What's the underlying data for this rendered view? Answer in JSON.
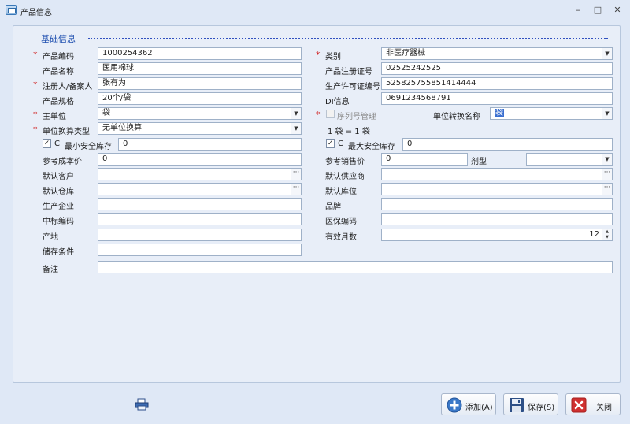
{
  "window": {
    "title": "产品信息",
    "controls": {
      "minimize": "–",
      "maximize": "□",
      "close": "✕"
    }
  },
  "section": {
    "title": "基础信息"
  },
  "left": {
    "product_code": {
      "label": "产品编码",
      "value": "1000254362"
    },
    "product_name": {
      "label": "产品名称",
      "value": "医用棉球"
    },
    "registrant": {
      "label": "注册人/备案人",
      "value": "张有为"
    },
    "spec": {
      "label": "产品规格",
      "value": "20个/袋"
    },
    "main_unit": {
      "label": "主单位",
      "value": "袋"
    },
    "unit_conv_type": {
      "label": "单位换算类型",
      "value": "无单位换算"
    },
    "min_stock": {
      "flag": "C",
      "label": "最小安全库存",
      "value": "0"
    },
    "ref_cost": {
      "label": "参考成本价",
      "value": "0"
    },
    "default_customer": {
      "label": "默认客户",
      "value": ""
    },
    "default_warehouse": {
      "label": "默认仓库",
      "value": ""
    },
    "manufacturer": {
      "label": "生产企业",
      "value": ""
    },
    "bid_code": {
      "label": "中标编码",
      "value": ""
    },
    "origin": {
      "label": "产地",
      "value": ""
    },
    "storage": {
      "label": "储存条件",
      "value": ""
    },
    "remark": {
      "label": "备注",
      "value": ""
    }
  },
  "right": {
    "category": {
      "label": "类别",
      "value": "非医疗器械"
    },
    "reg_cert": {
      "label": "产品注册证号",
      "value": "02525242525"
    },
    "license": {
      "label": "生产许可证编号",
      "value": "525825755851414444"
    },
    "di": {
      "label": "DI信息",
      "value": "0691234568791"
    },
    "serial_mgmt": {
      "label": "序列号管理"
    },
    "unit_conv_name": {
      "label": "单位转换名称",
      "value": "袋"
    },
    "conversion": "1 袋 = 1 袋",
    "max_stock": {
      "flag": "C",
      "label": "最大安全库存",
      "value": "0"
    },
    "ref_price": {
      "label": "参考销售价",
      "value": "0"
    },
    "dosage_form": {
      "label": "剂型",
      "value": ""
    },
    "default_supplier": {
      "label": "默认供应商",
      "value": ""
    },
    "default_location": {
      "label": "默认库位",
      "value": ""
    },
    "brand": {
      "label": "品牌",
      "value": ""
    },
    "med_code": {
      "label": "医保编码",
      "value": ""
    },
    "valid_months": {
      "label": "有效月数",
      "value": "12"
    }
  },
  "markers": {
    "required": "*",
    "dropdown": "▼",
    "ellipsis": "···",
    "spin_up": "▲",
    "spin_down": "▼",
    "check": "✓"
  },
  "buttons": {
    "add": {
      "label": "添加(A)",
      "icon": "plus-circle-icon",
      "color": "#3a78c8"
    },
    "save": {
      "label": "保存(S)",
      "icon": "floppy-disk-icon",
      "color": "#2d4f86"
    },
    "close": {
      "label": "关闭",
      "icon": "red-x-icon",
      "color": "#d03030"
    }
  }
}
